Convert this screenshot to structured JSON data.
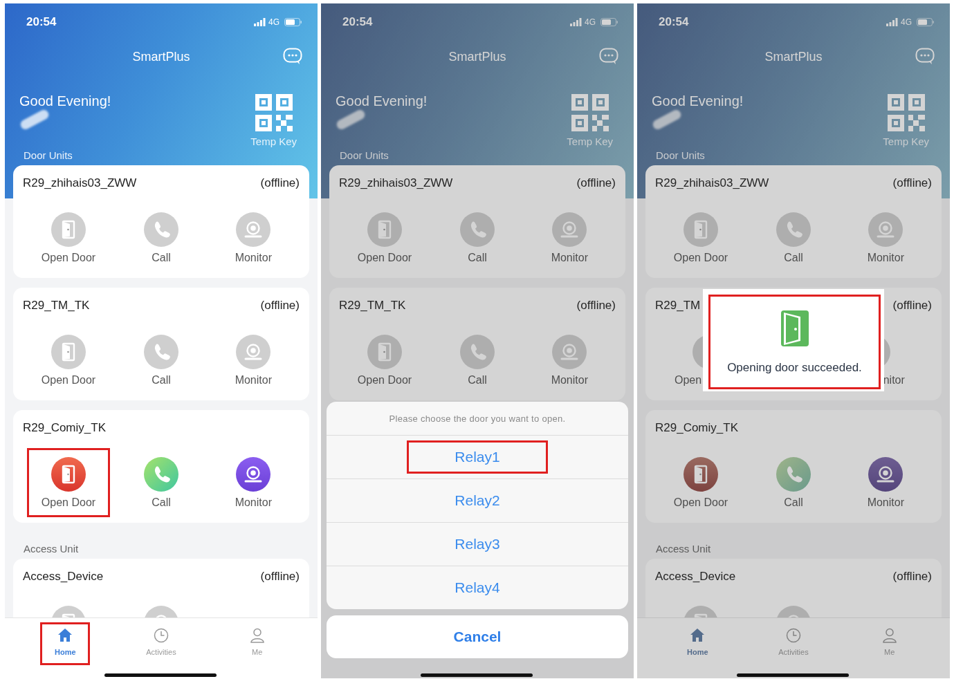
{
  "screens": [
    {
      "status_bar": {
        "time": "20:54",
        "network": "4G"
      },
      "header": {
        "title": "SmartPlus"
      },
      "greeting": "Good Evening!",
      "temp_key": {
        "label": "Temp Key"
      },
      "dimmed": false,
      "sections": [
        {
          "title": "Door Units",
          "devices": [
            {
              "name": "R29_zhihais03_ZWW",
              "status": "(offline)",
              "online": false,
              "actions": [
                {
                  "kind": "open_door",
                  "label": "Open Door",
                  "highlighted": false
                },
                {
                  "kind": "call",
                  "label": "Call",
                  "highlighted": false
                },
                {
                  "kind": "monitor",
                  "label": "Monitor",
                  "highlighted": false
                }
              ]
            },
            {
              "name": "R29_TM_TK",
              "status": "(offline)",
              "online": false,
              "actions": [
                {
                  "kind": "open_door",
                  "label": "Open Door",
                  "highlighted": false
                },
                {
                  "kind": "call",
                  "label": "Call",
                  "highlighted": false
                },
                {
                  "kind": "monitor",
                  "label": "Monitor",
                  "highlighted": false
                }
              ]
            },
            {
              "name": "R29_Comiy_TK",
              "online": true,
              "actions": [
                {
                  "kind": "open_door",
                  "label": "Open Door",
                  "highlighted": true
                },
                {
                  "kind": "call",
                  "label": "Call",
                  "highlighted": false
                },
                {
                  "kind": "monitor",
                  "label": "Monitor",
                  "highlighted": false
                }
              ]
            }
          ]
        },
        {
          "title": "Access Unit",
          "devices": [
            {
              "name": "Access_Device",
              "status": "(offline)",
              "online": false,
              "actions": [
                {
                  "kind": "open_door",
                  "highlighted": false
                },
                {
                  "kind": "monitor",
                  "highlighted": false
                }
              ]
            }
          ]
        }
      ],
      "tab_bar": [
        {
          "kind": "home",
          "label": "Home",
          "selected": true,
          "highlighted": true
        },
        {
          "kind": "activities",
          "label": "Activities",
          "selected": false,
          "highlighted": false
        },
        {
          "kind": "me",
          "label": "Me",
          "selected": false,
          "highlighted": false
        }
      ]
    },
    {
      "status_bar": {
        "time": "20:54",
        "network": "4G"
      },
      "header": {
        "title": "SmartPlus"
      },
      "greeting": "Good Evening!",
      "temp_key": {
        "label": "Temp Key"
      },
      "dimmed": true,
      "sections": [
        {
          "title": "Door Units",
          "devices": [
            {
              "name": "R29_zhihais03_ZWW",
              "status": "(offline)",
              "online": false,
              "actions": [
                {
                  "kind": "open_door",
                  "label": "Open Door",
                  "highlighted": false
                },
                {
                  "kind": "call",
                  "label": "Call",
                  "highlighted": false
                },
                {
                  "kind": "monitor",
                  "label": "Monitor",
                  "highlighted": false
                }
              ]
            },
            {
              "name": "R29_TM_TK",
              "status": "(offline)",
              "online": false,
              "actions": [
                {
                  "kind": "open_door",
                  "label": "Open Door",
                  "highlighted": false
                },
                {
                  "kind": "call",
                  "label": "Call",
                  "highlighted": false
                },
                {
                  "kind": "monitor",
                  "label": "Monitor",
                  "highlighted": false
                }
              ]
            }
          ]
        }
      ],
      "action_sheet": {
        "title": "Please choose the door you want to open.",
        "options": [
          {
            "label": "Relay1",
            "highlighted": true
          },
          {
            "label": "Relay2",
            "highlighted": false
          },
          {
            "label": "Relay3",
            "highlighted": false
          },
          {
            "label": "Relay4",
            "highlighted": false
          }
        ],
        "cancel": "Cancel"
      }
    },
    {
      "status_bar": {
        "time": "20:54",
        "network": "4G"
      },
      "header": {
        "title": "SmartPlus"
      },
      "greeting": "Good Evening!",
      "temp_key": {
        "label": "Temp Key"
      },
      "dimmed": true,
      "sections": [
        {
          "title": "Door Units",
          "devices": [
            {
              "name": "R29_zhihais03_ZWW",
              "status": "(offline)",
              "online": false,
              "actions": [
                {
                  "kind": "open_door",
                  "label": "Open Door",
                  "highlighted": false
                },
                {
                  "kind": "call",
                  "label": "Call",
                  "highlighted": false
                },
                {
                  "kind": "monitor",
                  "label": "Monitor",
                  "highlighted": false
                }
              ]
            },
            {
              "name": "R29_TM",
              "status": "(offline)",
              "online": false,
              "actions": [
                {
                  "kind": "open_door",
                  "label": "Open",
                  "clipped_right": true,
                  "highlighted": false
                },
                {
                  "kind": "monitor",
                  "label": "nitor",
                  "clipped_left": true,
                  "highlighted": false
                }
              ]
            },
            {
              "name": "R29_Comiy_TK",
              "online": true,
              "actions": [
                {
                  "kind": "open_door",
                  "label": "Open Door",
                  "highlighted": false
                },
                {
                  "kind": "call",
                  "label": "Call",
                  "highlighted": false
                },
                {
                  "kind": "monitor",
                  "label": "Monitor",
                  "highlighted": false
                }
              ]
            }
          ]
        },
        {
          "title": "Access Unit",
          "devices": [
            {
              "name": "Access_Device",
              "status": "(offline)",
              "online": false,
              "actions": [
                {
                  "kind": "open_door",
                  "highlighted": false
                },
                {
                  "kind": "monitor",
                  "highlighted": false
                }
              ]
            }
          ]
        }
      ],
      "tab_bar": [
        {
          "kind": "home",
          "label": "Home",
          "selected": true,
          "highlighted": false
        },
        {
          "kind": "activities",
          "label": "Activities",
          "selected": false,
          "highlighted": false
        },
        {
          "kind": "me",
          "label": "Me",
          "selected": false,
          "highlighted": false
        }
      ],
      "toast": {
        "message": "Opening door succeeded.",
        "highlighted": true
      }
    }
  ]
}
